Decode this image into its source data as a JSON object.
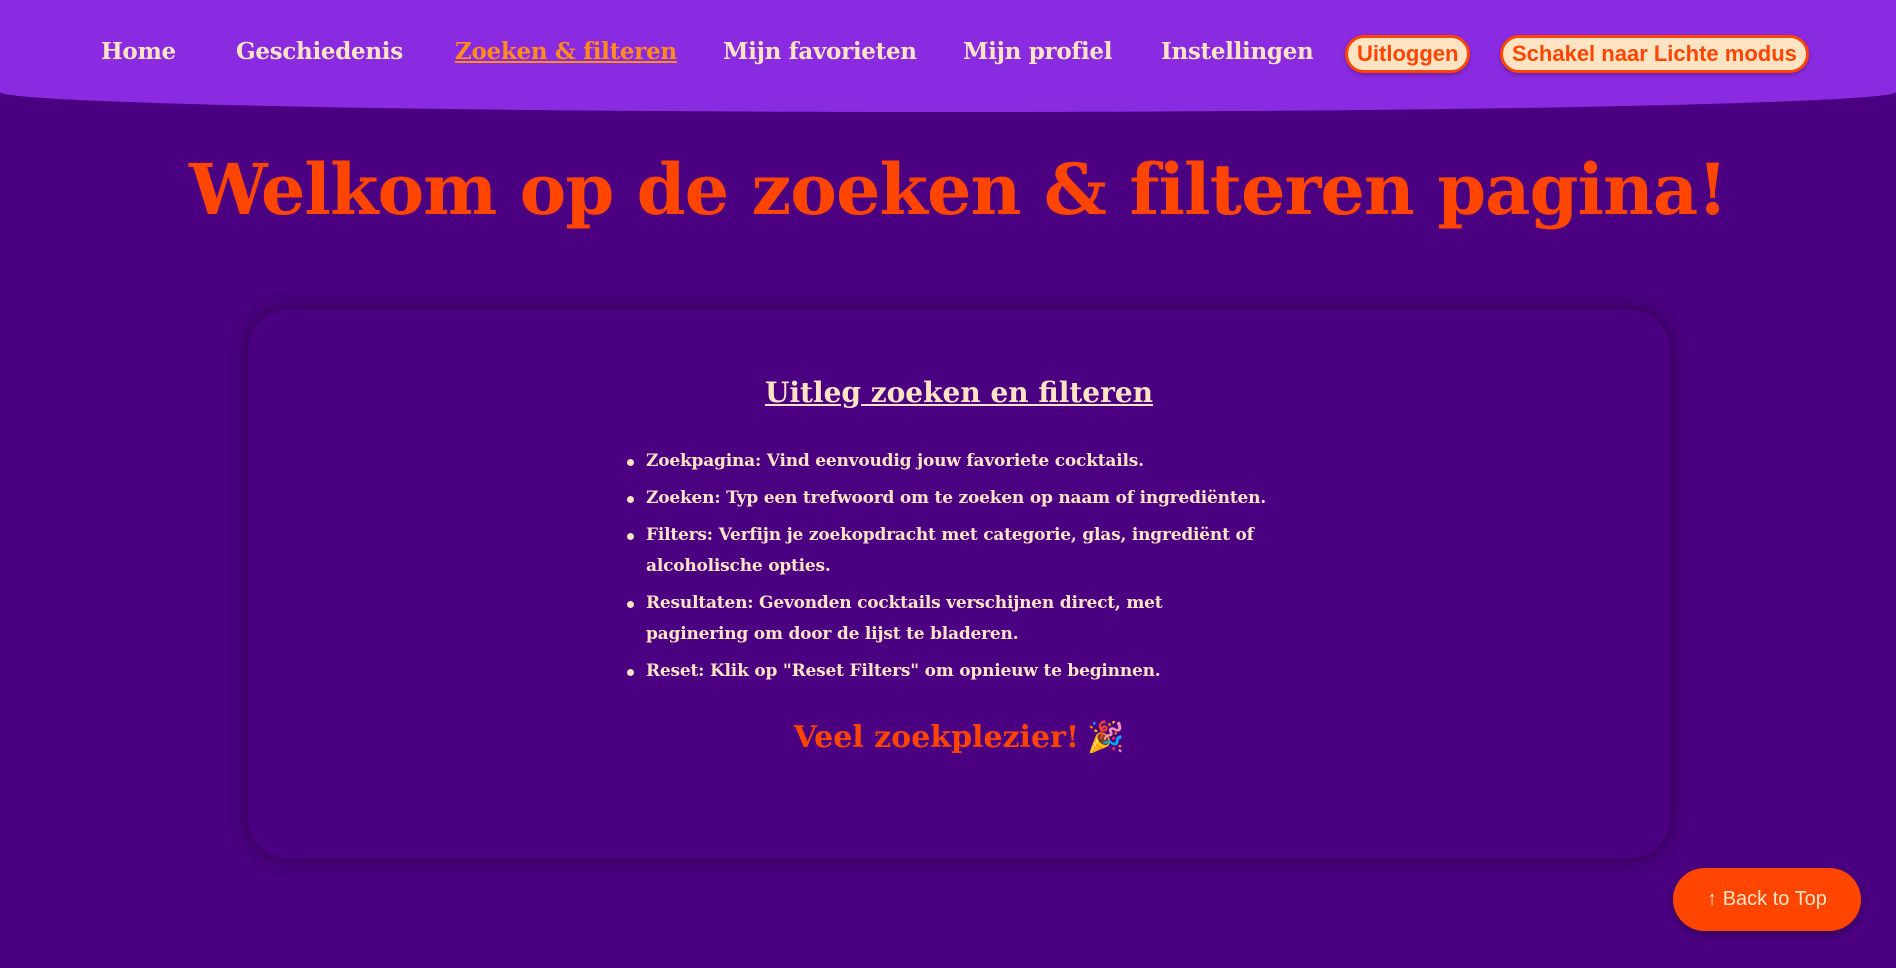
{
  "nav": {
    "links": [
      {
        "label": "Home"
      },
      {
        "label": "Geschiedenis"
      },
      {
        "label": "Zoeken & filteren",
        "active": true
      },
      {
        "label": "Mijn favorieten"
      },
      {
        "label": "Mijn profiel"
      },
      {
        "label": "Instellingen"
      }
    ],
    "logout_label": "Uitloggen",
    "theme_toggle_label": "Schakel naar Lichte modus"
  },
  "main": {
    "title": "Welkom op de zoeken & filteren pagina!"
  },
  "card": {
    "title": "Uitleg zoeken en filteren",
    "items": [
      "Zoekpagina: Vind eenvoudig jouw favoriete cocktails.",
      "Zoeken: Typ een trefwoord om te zoeken op naam of ingrediënten.",
      "Filters: Verfijn je zoekopdracht met categorie, glas, ingrediënt of alcoholische opties.",
      "Resultaten: Gevonden cocktails verschijnen direct, met paginering om door de lijst te bladeren.",
      "Reset: Klik op \"Reset Filters\" om opnieuw te beginnen."
    ],
    "closing": "Veel zoekplezier!",
    "closing_icon": "🎉"
  },
  "back_to_top": {
    "label": "↑ Back to Top"
  },
  "colors": {
    "background": "#4b0082",
    "nav_background": "#8a2be2",
    "accent": "#ff4500",
    "text_light": "#ffe4c4",
    "active_link": "#ff8c1a"
  }
}
